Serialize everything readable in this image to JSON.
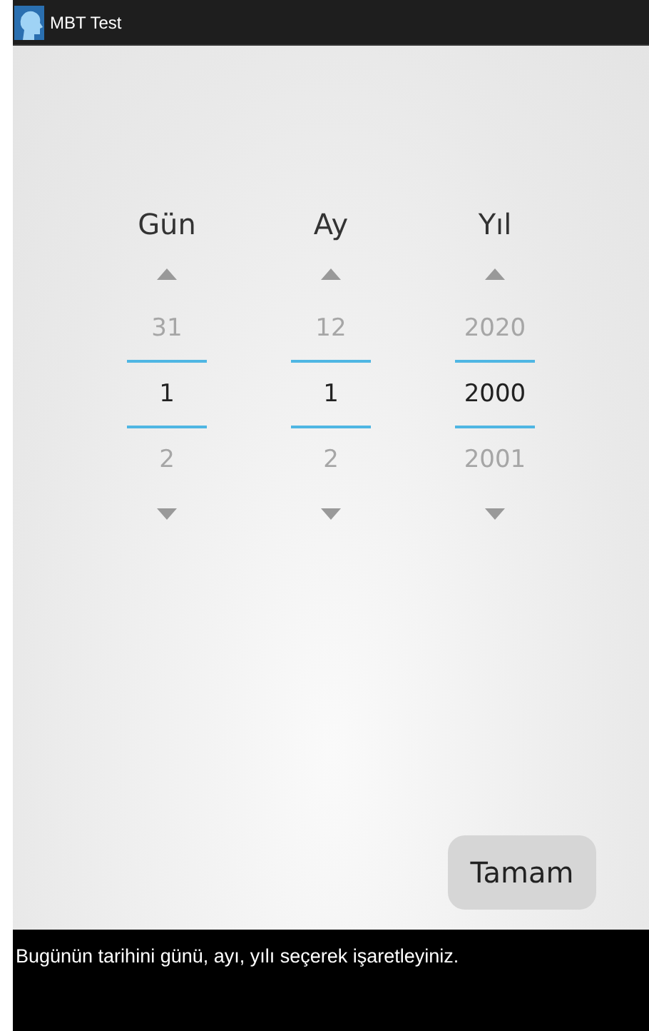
{
  "app_bar": {
    "title": "MBT Test"
  },
  "pickers": [
    {
      "label": "Gün",
      "previous": "31",
      "current": "1",
      "next": "2"
    },
    {
      "label": "Ay",
      "previous": "12",
      "current": "1",
      "next": "2"
    },
    {
      "label": "Yıl",
      "previous": "2020",
      "current": "2000",
      "next": "2001"
    }
  ],
  "confirm_button": "Tamam",
  "instruction": "Bugünün tarihini günü, ayı, yılı seçerek işaretleyiniz."
}
